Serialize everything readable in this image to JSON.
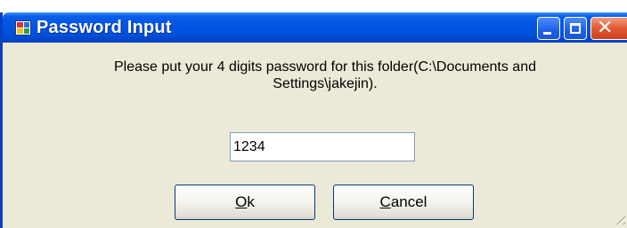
{
  "window": {
    "title": "Password Input",
    "app_icon": "app-window-icon",
    "controls": {
      "minimize_icon": "minimize-icon",
      "maximize_icon": "maximize-icon",
      "close_icon": "close-icon"
    }
  },
  "dialog": {
    "message_line1": "Please put your 4 digits password for this folder(C:\\Documents and",
    "message_line2": "Settings\\jakejin).",
    "password_value": "1234",
    "ok_label_mnemonic": "O",
    "ok_label_rest": "k",
    "cancel_label_mnemonic": "C",
    "cancel_label_rest": "ancel"
  },
  "colors": {
    "titlebar": "#0054e3",
    "dialog_background": "#ece9d8",
    "close_button": "#e25a32"
  }
}
